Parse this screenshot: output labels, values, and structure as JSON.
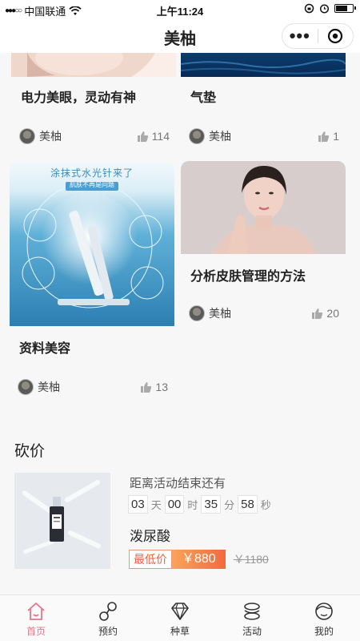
{
  "status_bar": {
    "carrier": "中国联通",
    "time": "上午11:24"
  },
  "nav": {
    "title": "美柚",
    "more_label": "•••"
  },
  "feed": {
    "cards": [
      {
        "title": "电力美眼，灵动有神",
        "author": "美柚",
        "likes": "114"
      },
      {
        "title": "气垫",
        "author": "美柚",
        "likes": "1"
      },
      {
        "title": "资料美容",
        "author": "美柚",
        "likes": "13",
        "image_text": {
          "headline": "涂抹式水光针来了",
          "sub": "肌肤不再是问题"
        }
      },
      {
        "title": "分析皮肤管理的方法",
        "author": "美柚",
        "likes": "20"
      }
    ]
  },
  "bargain": {
    "section_title": "砍价",
    "countdown_label": "距离活动结束还有",
    "countdown": {
      "days": "03",
      "days_unit": "天",
      "hours": "00",
      "hours_unit": "时",
      "minutes": "35",
      "minutes_unit": "分",
      "seconds": "58",
      "seconds_unit": "秒"
    },
    "product_name": "泼尿酸",
    "price_tag": "最低价",
    "price": "￥880",
    "original_price": "￥1180"
  },
  "tabs": [
    {
      "label": "首页",
      "icon": "home-icon",
      "active": true
    },
    {
      "label": "预约",
      "icon": "link-icon",
      "active": false
    },
    {
      "label": "种草",
      "icon": "diamond-icon",
      "active": false
    },
    {
      "label": "活动",
      "icon": "stack-icon",
      "active": false
    },
    {
      "label": "我的",
      "icon": "face-icon",
      "active": false
    }
  ],
  "colors": {
    "accent": "#e8748a",
    "price_gradient_start": "#f9a45a",
    "price_gradient_end": "#f36a3f",
    "price_tag": "#e8613e"
  }
}
